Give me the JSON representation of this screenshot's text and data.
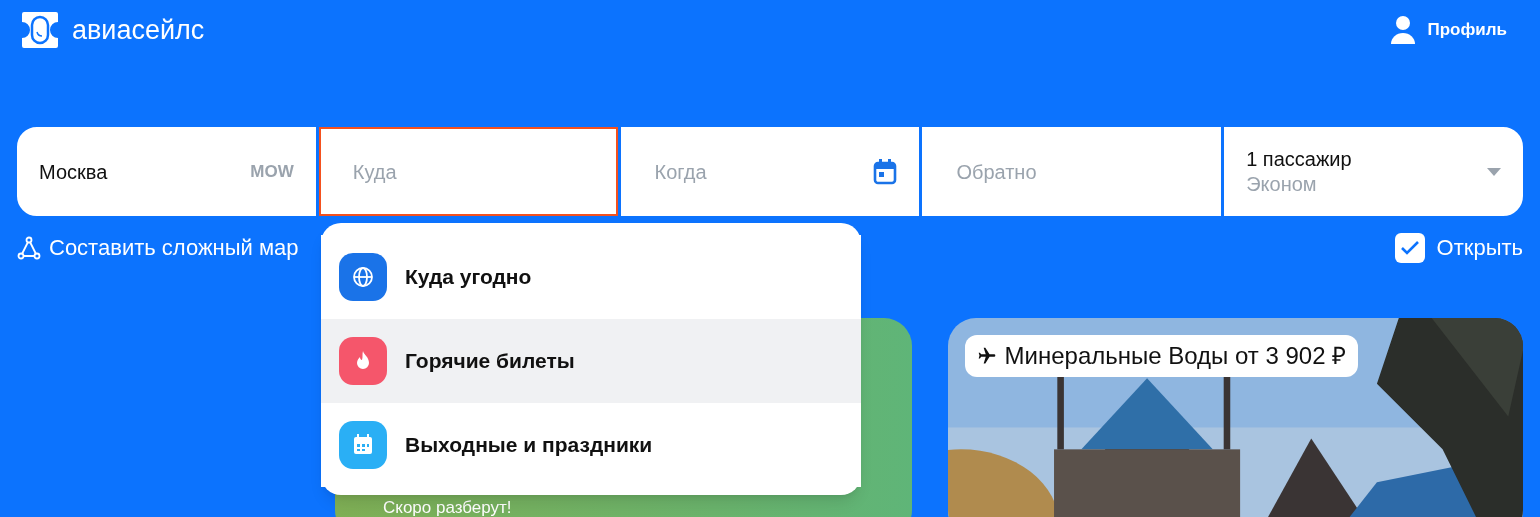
{
  "header": {
    "logo_text": "авиасейлс",
    "profile": "Профиль"
  },
  "search": {
    "fields": [
      {
        "kind": "origin",
        "value": "Москва",
        "code": "MOW",
        "focused": false
      },
      {
        "kind": "destination",
        "placeholder": "Куда",
        "focused": true
      },
      {
        "kind": "date",
        "placeholder": "Когда",
        "focused": false
      },
      {
        "kind": "return",
        "placeholder": "Обратно",
        "focused": false
      },
      {
        "kind": "passengers",
        "value": "1 пассажир",
        "subtitle": "Эконом",
        "focused": false
      }
    ]
  },
  "route_link": "Составить сложный мар",
  "open_option": {
    "label": "Открыть",
    "checked": true
  },
  "dropdown": {
    "items": [
      {
        "kind": "globe",
        "label": "Куда угодно",
        "color": "#1a73e8",
        "selected": false
      },
      {
        "kind": "fire",
        "label": "Горячие билеты",
        "color": "#f5566b",
        "selected": true
      },
      {
        "kind": "calendar",
        "label": "Выходные и праздники",
        "color": "#2aaff5",
        "selected": false
      }
    ]
  },
  "cards": [
    {
      "kind": "promo",
      "text": "Скоро разберут!"
    },
    {
      "kind": "picture",
      "badge": "Минеральные Воды от 3 902 ₽"
    }
  ]
}
